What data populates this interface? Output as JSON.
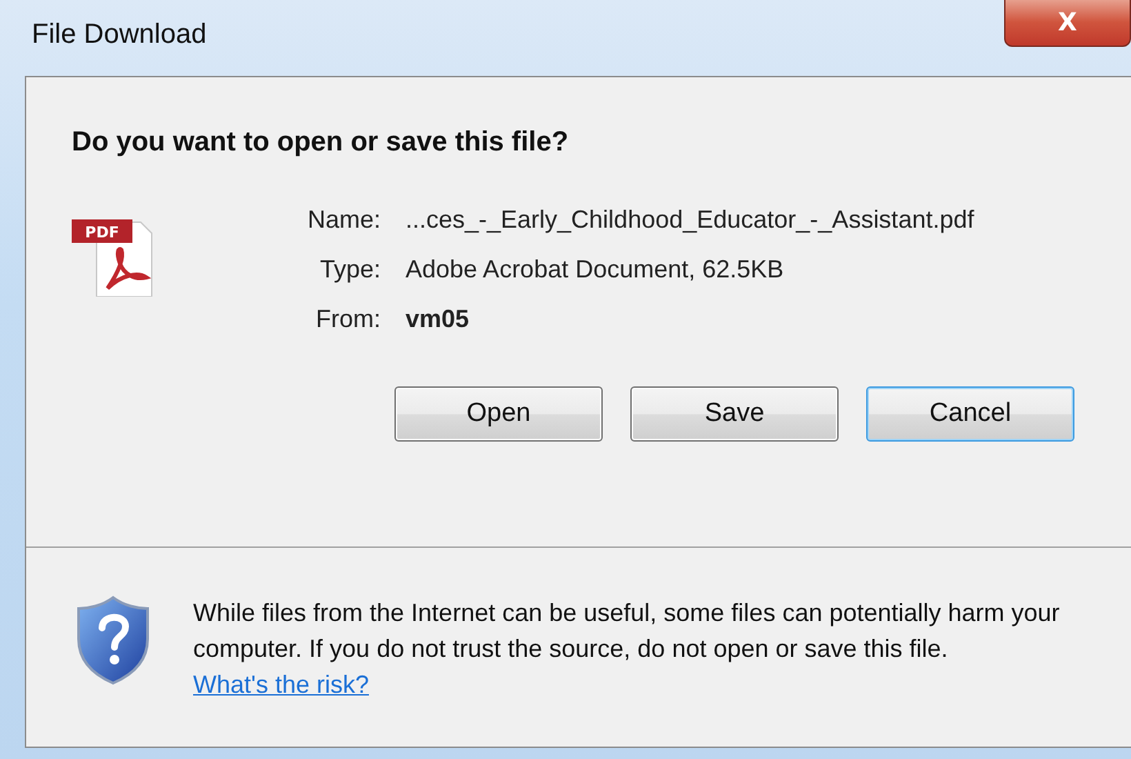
{
  "window": {
    "title": "File Download",
    "close_label": "X"
  },
  "heading": "Do you want to open or save this file?",
  "file_icon_label": "PDF",
  "details": [
    {
      "label": "Name:",
      "value": "...ces_-_Early_Childhood_Educator_-_Assistant.pdf",
      "bold": false
    },
    {
      "label": "Type:",
      "value": "Adobe Acrobat Document, 62.5KB",
      "bold": false
    },
    {
      "label": "From:",
      "value": "vm05",
      "bold": true
    }
  ],
  "buttons": [
    {
      "label": "Open",
      "focused": false
    },
    {
      "label": "Save",
      "focused": false
    },
    {
      "label": "Cancel",
      "focused": true
    }
  ],
  "warning": {
    "text": "While files from the Internet can be useful, some files can potentially harm your computer. If you do not trust the source, do not open or save this file.",
    "link": "What's the risk?"
  }
}
